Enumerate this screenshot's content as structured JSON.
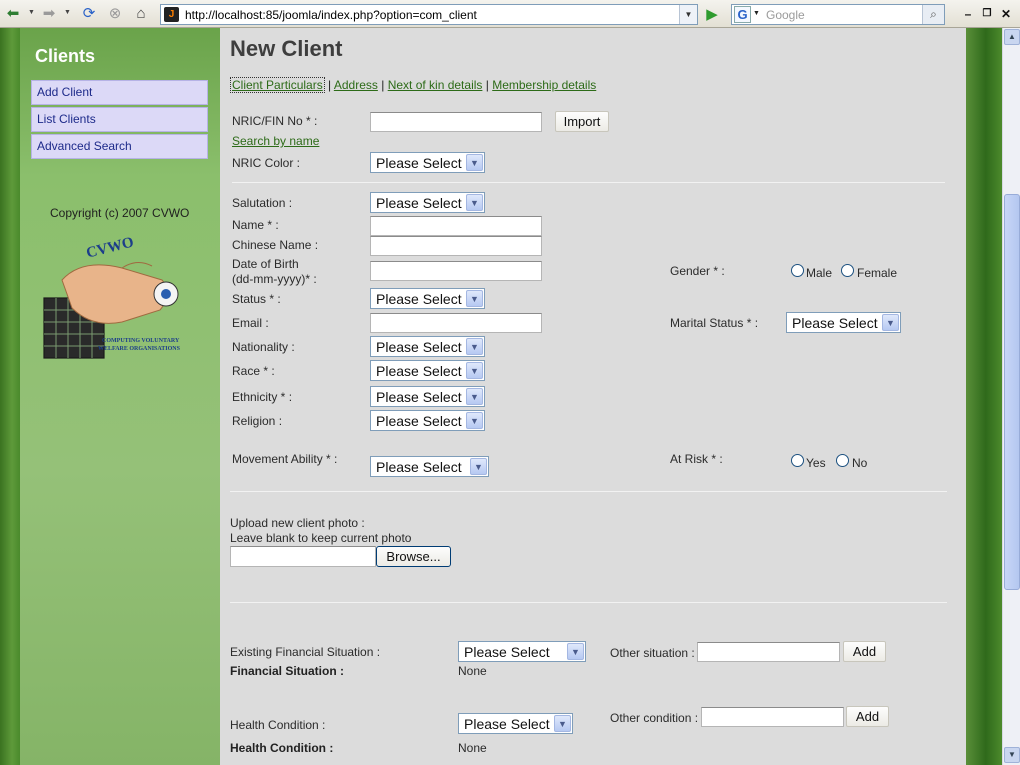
{
  "browser": {
    "url": "http://localhost:85/joomla/index.php?option=com_client",
    "search_placeholder": "Google",
    "search_engine_letter": "G"
  },
  "sidebar": {
    "title": "Clients",
    "items": [
      {
        "label": "Add Client"
      },
      {
        "label": "List Clients"
      },
      {
        "label": "Advanced Search"
      }
    ],
    "copyright": "Copyright (c) 2007 CVWO",
    "logo_text": "CVWO",
    "logo_caption_1": "COMPUTING VOLUNTARY",
    "logo_caption_2": "WELFARE ORGANISATIONS"
  },
  "page": {
    "title": "New Client",
    "tabs": [
      {
        "label": "Client Particulars"
      },
      {
        "label": "Address"
      },
      {
        "label": "Next of kin details"
      },
      {
        "label": "Membership details"
      }
    ],
    "tab_separator": "|"
  },
  "form": {
    "nric_label": "NRIC/FIN No * :",
    "import_button": "Import",
    "search_by_name": "Search by name",
    "nric_color_label": "NRIC Color :",
    "salutation_label": "Salutation :",
    "name_label": "Name * :",
    "chinese_name_label": "Chinese Name :",
    "dob_label_1": "Date of Birth",
    "dob_label_2": "(dd-mm-yyyy)* :",
    "gender_label": "Gender * :",
    "gender_options": [
      "Male",
      "Female"
    ],
    "status_label": "Status * :",
    "email_label": "Email :",
    "marital_status_label": "Marital Status * :",
    "nationality_label": "Nationality :",
    "race_label": "Race * :",
    "ethnicity_label": "Ethnicity * :",
    "religion_label": "Religion :",
    "movement_ability_label": "Movement Ability * :",
    "at_risk_label": "At Risk * :",
    "at_risk_options": [
      "Yes",
      "No"
    ],
    "select_default": "Please Select",
    "upload_label_1": "Upload new client photo :",
    "upload_label_2": "Leave blank to keep current photo",
    "browse_button": "Browse...",
    "existing_financial_label": "Existing Financial Situation :",
    "other_situation_label": "Other situation :",
    "add_button": "Add",
    "financial_situation_label": "Financial Situation :",
    "financial_situation_value": "None",
    "health_condition_select_label": "Health Condition :",
    "other_condition_label": "Other condition :",
    "health_condition_label": "Health Condition :",
    "health_condition_value": "None"
  }
}
